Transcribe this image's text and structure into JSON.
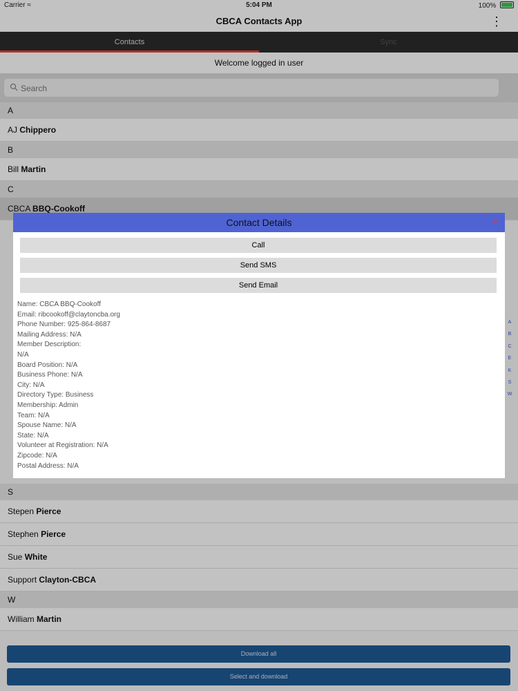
{
  "status_bar": {
    "carrier": "Carrier",
    "time": "5:04 PM",
    "battery": "100%"
  },
  "nav": {
    "title": "CBCA Contacts App"
  },
  "tabs": [
    {
      "label": "Contacts",
      "active": true
    },
    {
      "label": "Sync",
      "active": false
    }
  ],
  "welcome": "Welcome logged in user",
  "search": {
    "placeholder": "Search",
    "value": ""
  },
  "list": {
    "sections": [
      {
        "header": "A",
        "items": [
          {
            "first": "AJ",
            "last": "Chippero"
          }
        ]
      },
      {
        "header": "B",
        "items": [
          {
            "first": "Bill",
            "last": "Martin"
          }
        ]
      },
      {
        "header": "C",
        "items": [
          {
            "first": "CBCA",
            "last": "BBQ-Cookoff",
            "selected": true
          }
        ]
      }
    ],
    "bottom_sections": [
      {
        "header": "S",
        "items": [
          {
            "first": "Stepen",
            "last": "Pierce"
          },
          {
            "first": "Stephen",
            "last": "Pierce"
          },
          {
            "first": "Sue",
            "last": "White"
          },
          {
            "first": "Support",
            "last": "Clayton-CBCA"
          }
        ]
      },
      {
        "header": "W",
        "items": [
          {
            "first": "William",
            "last": "Martin"
          }
        ]
      }
    ]
  },
  "index_letters": [
    "A",
    "B",
    "C",
    "E",
    "K",
    "S",
    "W"
  ],
  "dialog": {
    "title": "Contact Details",
    "close_label": "×",
    "buttons": [
      "Call",
      "Send SMS",
      "Send Email"
    ],
    "details": [
      "Name:  CBCA BBQ-Cookoff",
      "Email:  ribcookoff@claytoncba.org",
      "Phone Number:  925-864-8687",
      "Mailing Address: N/A",
      "Member  Description:",
      "N/A",
      "Board Position:  N/A",
      "Business Phone: N/A",
      "City:  N/A",
      "Directory Type:  Business",
      "Membership: Admin",
      "Team:  N/A",
      "Spouse Name: N/A",
      "State:  N/A",
      "Volunteer at Registration:  N/A",
      "Zipcode:  N/A",
      "Postal Address:   N/A"
    ]
  },
  "footer": {
    "download_all": "Download all",
    "select_download": "Select and download"
  },
  "colors": {
    "tab_bar": "#2c2c2c",
    "tab_indicator": "#e8413c",
    "dialog_header": "#4f63d3",
    "footer_button": "#1f5b96",
    "index_letters": "#3b57c9"
  }
}
